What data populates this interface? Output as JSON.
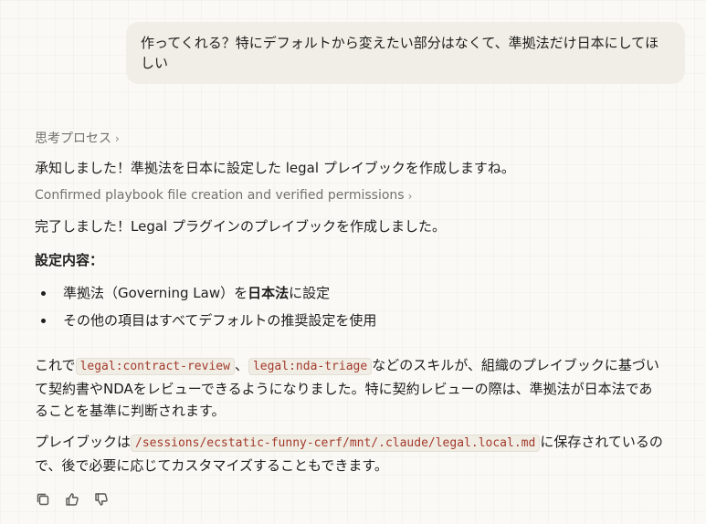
{
  "user_message": "作ってくれる？特にデフォルトから変えたい部分はなくて、準拠法だけ日本にしてほしい",
  "thinking_label": "思考プロセス",
  "reply_intro": "承知しました！準拠法を日本に設定した legal プレイブックを作成しますね。",
  "tool_summary": "Confirmed playbook file creation and verified permissions",
  "completion": "完了しました！Legal プラグインのプレイブックを作成しました。",
  "settings_heading": "設定内容：",
  "bullets": {
    "b1_pre": "準拠法（Governing Law）を",
    "b1_bold": "日本法",
    "b1_post": "に設定",
    "b2": "その他の項目はすべてデフォルトの推奨設定を使用"
  },
  "para1": {
    "pre": "これで",
    "code1": "legal:contract-review",
    "sep": "、",
    "code2": "legal:nda-triage",
    "post": "などのスキルが、組織のプレイブックに基づいて契約書やNDAをレビューできるようになりました。特に契約レビューの際は、準拠法が日本法であることを基準に判断されます。"
  },
  "para2": {
    "pre": "プレイブックは",
    "code": "/sessions/ecstatic-funny-cerf/mnt/.claude/legal.local.md",
    "post": "に保存されているので、後で必要に応じてカスタマイズすることもできます。"
  },
  "actions": {
    "copy_icon": "copy-icon",
    "thumbs_up_icon": "thumbs-up-icon",
    "thumbs_down_icon": "thumbs-down-icon"
  }
}
